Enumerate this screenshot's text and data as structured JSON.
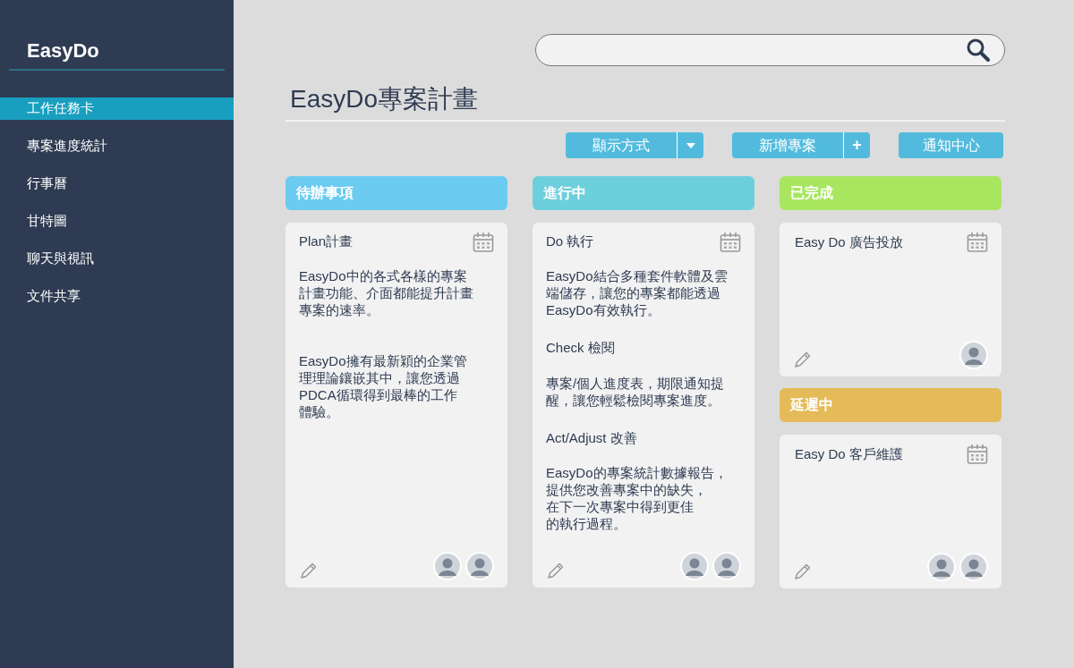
{
  "sidebar": {
    "logo": "EasyDo",
    "items": [
      {
        "label": "工作任務卡",
        "selected": true
      },
      {
        "label": "專案進度統計",
        "selected": false
      },
      {
        "label": "行事曆",
        "selected": false
      },
      {
        "label": "甘特圖",
        "selected": false
      },
      {
        "label": "聊天與視訊",
        "selected": false
      },
      {
        "label": "文件共享",
        "selected": false
      }
    ]
  },
  "page_title": "EasyDo專案計畫",
  "toolbar": [
    {
      "label": "顯示方式",
      "kind": "dropdown"
    },
    {
      "label": "新增專案",
      "kind": "add",
      "addon": "+"
    },
    {
      "label": "通知中心",
      "kind": "plain"
    }
  ],
  "columns": [
    {
      "groups": [
        {
          "header": "待辦事項",
          "color": "#6ccbf0",
          "cards": [
            {
              "title": "Plan計畫",
              "paragraphs": [
                {
                  "kind": "text",
                  "lines": [
                    "EasyDo中的各式各樣的專案",
                    "計畫功能、介面都能提升計畫",
                    "專案的速率。"
                  ]
                },
                {
                  "kind": "text",
                  "lines": [
                    "EasyDo擁有最新穎的企業管",
                    "理理論鑲嵌其中，讓您透過",
                    "PDCA循環得到最棒的工作",
                    "體驗。"
                  ]
                }
              ],
              "avatars": [
                {
                  "kind": "photo"
                },
                {
                  "kind": "photo"
                }
              ]
            }
          ]
        }
      ]
    },
    {
      "groups": [
        {
          "header": "進行中",
          "color": "#6ecfdc",
          "cards": [
            {
              "title": "Do 執行",
              "paragraphs": [
                {
                  "kind": "text",
                  "lines": [
                    "EasyDo結合多種套件軟體及雲",
                    "端儲存，讓您的專案都能透過",
                    "EasyDo有效執行。"
                  ]
                },
                {
                  "kind": "heading",
                  "lines": [
                    "Check 檢閱"
                  ]
                },
                {
                  "kind": "text",
                  "lines": [
                    "專案/個人進度表，期限通知提",
                    "醒，讓您輕鬆檢閱專案進度。"
                  ]
                },
                {
                  "kind": "heading",
                  "lines": [
                    "Act/Adjust 改善"
                  ]
                },
                {
                  "kind": "text",
                  "lines": [
                    "EasyDo的專案統計數據報告，",
                    "提供您改善專案中的缺失，",
                    "在下一次專案中得到更佳",
                    "的執行過程。"
                  ]
                }
              ],
              "avatars": [
                {
                  "kind": "photo"
                },
                {
                  "kind": "photo"
                }
              ]
            }
          ]
        }
      ]
    },
    {
      "groups": [
        {
          "header": "已完成",
          "color": "#a8e660",
          "cards": [
            {
              "title": "Easy Do 廣告投放",
              "avatars": [
                {
                  "kind": "photo"
                }
              ]
            }
          ]
        },
        {
          "header": "延遲中",
          "color": "#e5bb5a",
          "cards": [
            {
              "title": "Easy Do 客戶維護",
              "avatars": [
                {
                  "kind": "photo"
                },
                {
                  "kind": "photo"
                }
              ]
            }
          ]
        }
      ]
    }
  ]
}
